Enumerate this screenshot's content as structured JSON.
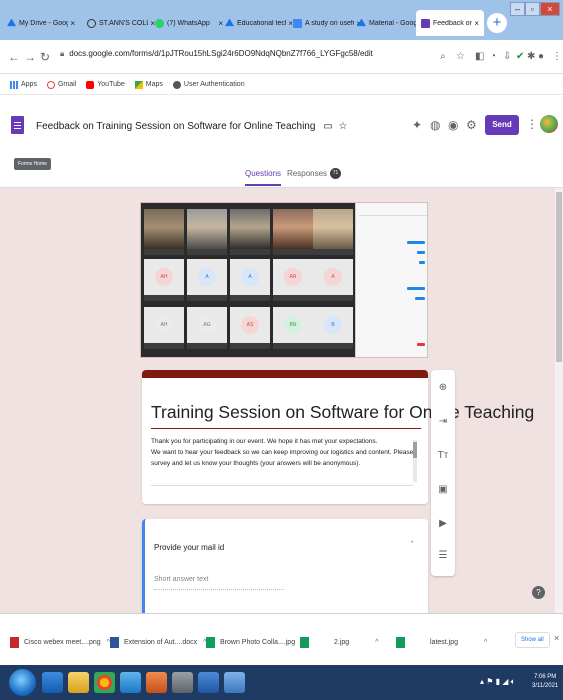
{
  "browser": {
    "tabs": [
      {
        "title": "My Drive - Google",
        "icon": "drive-icon",
        "color": "#1a73e8"
      },
      {
        "title": "ST.ANN'S COLLEGE",
        "icon": "site-icon",
        "color": "#333333"
      },
      {
        "title": "(7) WhatsApp",
        "icon": "whatsapp-icon",
        "color": "#25d366"
      },
      {
        "title": "Educational techno",
        "icon": "drive-icon",
        "color": "#1a73e8"
      },
      {
        "title": "A study on useful",
        "icon": "forms-icon",
        "color": "#4285f4"
      },
      {
        "title": "Material - Google",
        "icon": "drive-icon",
        "color": "#1a73e8"
      },
      {
        "title": "Feedback on Train",
        "icon": "forms-icon",
        "color": "#673ab7",
        "active": true
      }
    ],
    "new_tab": "+",
    "url": "docs.google.com/forms/d/1pJTRou15hLSgi24r6DO9NdqNQbnZ7f766_LYGFgc58/edit",
    "bookmarks": [
      {
        "label": "Apps",
        "icon": "apps-icon",
        "color": "#4285f4"
      },
      {
        "label": "Gmail",
        "icon": "gmail-icon",
        "color": "#ea4335"
      },
      {
        "label": "YouTube",
        "icon": "youtube-icon",
        "color": "#ff0000"
      },
      {
        "label": "Maps",
        "icon": "maps-icon",
        "color": "#34a853"
      },
      {
        "label": "User Authentication",
        "icon": "site-icon",
        "color": "#555555"
      }
    ]
  },
  "forms": {
    "title": "Feedback on Training Session on Software for Online Teaching",
    "send_label": "Send",
    "home_label": "Forms Home",
    "tabs": {
      "questions": "Questions",
      "responses": "Responses",
      "response_count": "71"
    },
    "accent_color": "#673ab7"
  },
  "form": {
    "heading": "Training Session on Software for Online Teaching",
    "description": [
      "Thank you for participating in our event. We hope it has met your expectations.",
      "We want to hear your feedback so we can keep improving our logistics and content. Please fill this quick",
      "survey and let us know your thoughts (your answers will be anonymous)."
    ],
    "theme_color": "#7b1c0e",
    "question": {
      "title": "Provide your mail id",
      "required_mark": "*",
      "placeholder": "Short answer text"
    }
  },
  "downloads": {
    "items": [
      {
        "name": "Cisco webex meet....png",
        "icon": "image-file-icon",
        "color": "#c62828"
      },
      {
        "name": "Extension of Aut....docx",
        "icon": "word-file-icon",
        "color": "#2b579a"
      },
      {
        "name": "Brown Photo Colla....jpg",
        "icon": "image-file-icon",
        "color": "#0f9d58"
      },
      {
        "name": "2.jpg",
        "icon": "image-file-icon",
        "color": "#0f9d58"
      },
      {
        "name": "latest.jpg",
        "icon": "image-file-icon",
        "color": "#0f9d58"
      }
    ],
    "show_all": "Show all"
  },
  "taskbar": {
    "time": "7:06 PM",
    "date": "3/11/2021"
  }
}
